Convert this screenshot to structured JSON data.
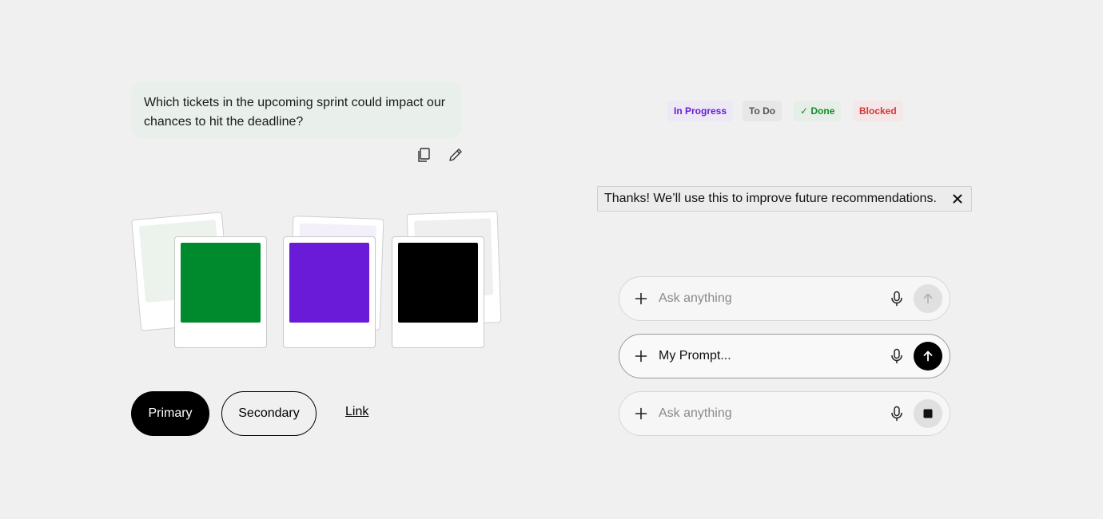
{
  "chat": {
    "message": "Which tickets in the upcoming sprint could impact our chances to hit the deadline?",
    "actions": [
      {
        "icon": "copy-icon"
      },
      {
        "icon": "edit-pencil-icon"
      }
    ]
  },
  "swatches": {
    "colors": [
      {
        "name": "green",
        "hex": "#008a2e",
        "back_tint": "#ecf2ec"
      },
      {
        "name": "purple",
        "hex": "#6a1bd8",
        "back_tint": "#f4f0fa"
      },
      {
        "name": "black",
        "hex": "#000000",
        "back_tint": "#efefef"
      }
    ]
  },
  "buttons": {
    "primary_label": "Primary",
    "secondary_label": "Secondary",
    "link_label": "Link"
  },
  "status_pills": [
    {
      "label": "In Progress",
      "color": "#6a1bd8"
    },
    {
      "label": "To Do",
      "color": "#555555"
    },
    {
      "label": "✓ Done",
      "color": "#128a2c"
    },
    {
      "label": "Blocked",
      "color": "#d63535"
    }
  ],
  "toast": {
    "message": "Thanks! We’ll use this to improve future recommendations.",
    "close_icon": "close-icon"
  },
  "prompts": [
    {
      "value": "",
      "placeholder": "Ask anything",
      "send_state": "disabled",
      "action_icon": "arrow-up-icon"
    },
    {
      "value": "My Prompt...",
      "placeholder": "Ask anything",
      "send_state": "enabled",
      "action_icon": "arrow-up-icon"
    },
    {
      "value": "",
      "placeholder": "Ask anything",
      "send_state": "stop",
      "action_icon": "stop-icon"
    }
  ]
}
